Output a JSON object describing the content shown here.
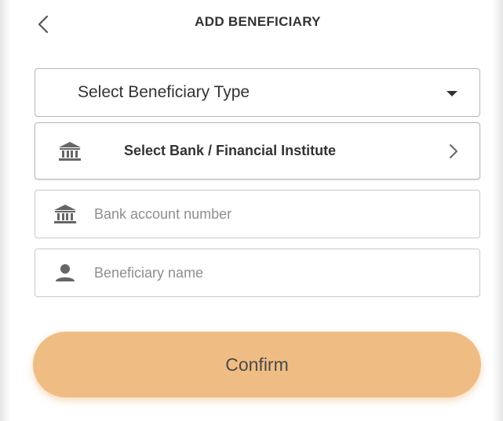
{
  "header": {
    "title": "ADD BENEFICIARY",
    "back_icon": "chevron-left-icon"
  },
  "form": {
    "beneficiary_type": {
      "label": "Select Beneficiary Type",
      "icon": "caret-down-icon"
    },
    "bank": {
      "label": "Select Bank / Financial Institute",
      "icon": "bank-icon",
      "trailing_icon": "chevron-right-icon"
    },
    "account_number": {
      "value": "",
      "placeholder": "Bank account number",
      "icon": "bank-icon"
    },
    "beneficiary_name": {
      "value": "",
      "placeholder": "Beneficiary name",
      "icon": "person-icon"
    }
  },
  "actions": {
    "confirm_label": "Confirm"
  },
  "colors": {
    "accent": "#efbd84",
    "text": "#333333",
    "placeholder": "#8e8e8e",
    "border": "#c9c9c9"
  }
}
